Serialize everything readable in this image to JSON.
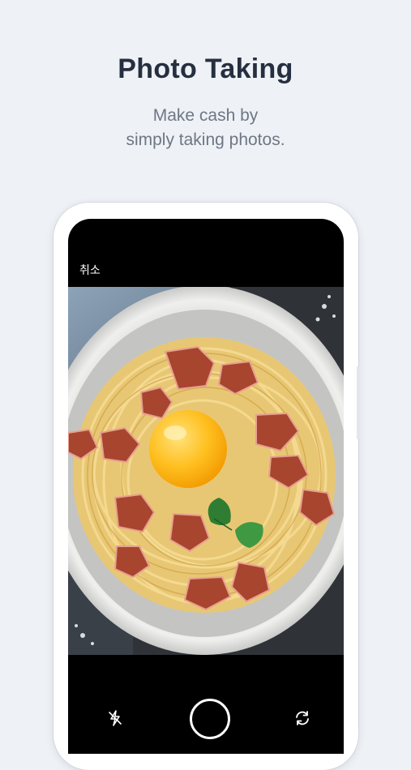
{
  "hero": {
    "title": "Photo Taking",
    "subtitle_line1": "Make cash by",
    "subtitle_line2": "simply taking photos."
  },
  "camera": {
    "cancel_label": "취소",
    "preview_subject": "carbonara pasta with egg yolk, bacon and basil",
    "controls": {
      "flash_icon": "flash-off-icon",
      "shutter_icon": "shutter-icon",
      "switch_icon": "switch-camera-icon"
    }
  },
  "colors": {
    "background": "#eef1f5",
    "title": "#262f40",
    "subtitle": "#6e7785",
    "phone_frame": "#ffffff",
    "screen": "#000000"
  }
}
